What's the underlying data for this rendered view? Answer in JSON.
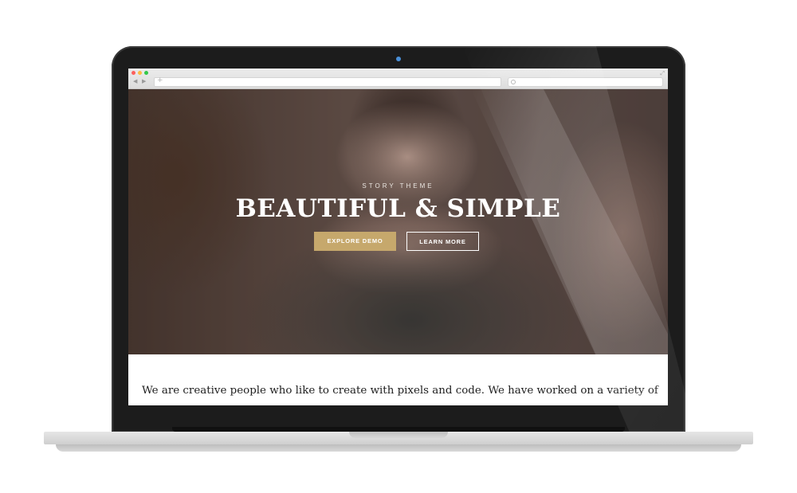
{
  "browser": {
    "back_arrow": "◀",
    "forward_arrow": "▶",
    "new_tab_plus": "+",
    "expand_glyph": "⤢",
    "url": ""
  },
  "hero": {
    "subtitle": "STORY THEME",
    "title": "BEAUTIFUL & SIMPLE",
    "primary_button": "EXPLORE DEMO",
    "secondary_button": "LEARN MORE"
  },
  "content": {
    "intro": "We are creative people who like to create with pixels and code. We have worked on a variety of"
  },
  "colors": {
    "accent": "#c6a86c",
    "bezel": "#1c1c1c",
    "dot_red": "#fc605c",
    "dot_yellow": "#fdbc40",
    "dot_green": "#34c84a"
  },
  "icons": {
    "window_controls": [
      "close-dot",
      "minimize-dot",
      "zoom-dot"
    ],
    "nav": [
      "back-arrow-icon",
      "forward-arrow-icon"
    ],
    "search": "search-icon",
    "fullscreen": "expand-icon"
  }
}
